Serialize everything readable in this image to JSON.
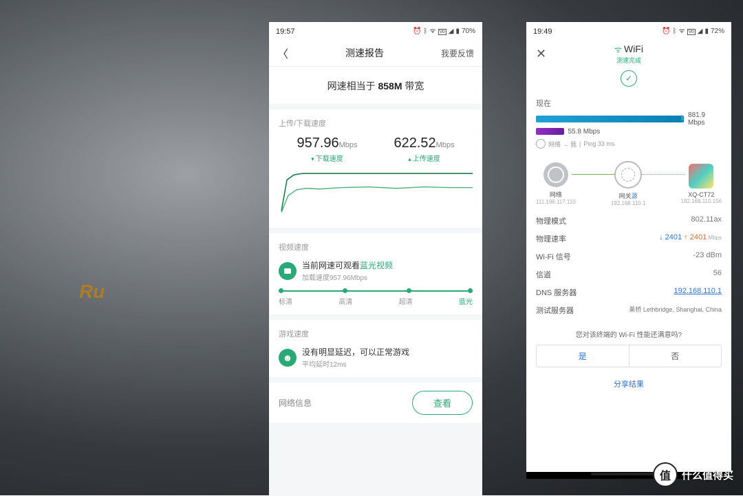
{
  "watermark": {
    "glyph": "值",
    "text": "什么值得买"
  },
  "left": {
    "status": {
      "time": "19:57",
      "battery": "70%"
    },
    "header": {
      "title": "测速报告",
      "feedback": "我要反馈"
    },
    "banner": {
      "prefix": "网速相当于 ",
      "value": "858M",
      "suffix": " 带宽"
    },
    "speed": {
      "section": "上传/下载速度",
      "download": {
        "value": "957.96",
        "unit": "Mbps",
        "label": "下载速度"
      },
      "upload": {
        "value": "622.52",
        "unit": "Mbps",
        "label": "上传速度"
      }
    },
    "video": {
      "section": "视频速度",
      "line1a": "当前网速可观看",
      "line1b": "蓝光视频",
      "line2": "加载速度957.96Mbps",
      "levels": {
        "l1": "标清",
        "l2": "高清",
        "l3": "超清",
        "l4": "蓝光"
      }
    },
    "game": {
      "section": "游戏速度",
      "line1": "没有明显延迟，可以正常游戏",
      "line2": "平均延时12ms"
    },
    "info": {
      "label": "网络信息",
      "button": "查看"
    }
  },
  "right": {
    "status": {
      "time": "19:49",
      "battery": "72%"
    },
    "title": "WiFi",
    "done": "测速完成",
    "now": "现在",
    "dl": "881.9 Mbps",
    "ul": "55.8 Mbps",
    "ping": {
      "label": "网络 → 我",
      "value": "Ping 33 ms"
    },
    "nodes": {
      "net": {
        "name": "网络",
        "ip": "111.198.117.110"
      },
      "gw": {
        "name": "网关",
        "suffix": "源",
        "ip": "192.168.110.1"
      },
      "dev": {
        "name": "XQ-CT72",
        "ip": "192.168.110.156"
      }
    },
    "kv": {
      "mode": {
        "k": "物理模式",
        "v": "802.11ax"
      },
      "rate": {
        "k": "物理速率",
        "down": "↓ 2401",
        "up": "↑ 2401",
        "unit": " Mbps"
      },
      "signal": {
        "k": "Wi-Fi 信号",
        "v": "-23 dBm"
      },
      "chan": {
        "k": "信道",
        "v": "56"
      },
      "dns": {
        "k": "DNS 服务器",
        "v": "192.168.110.1"
      },
      "server": {
        "k": "测试服务器",
        "v": "莱桥 Lethbridge, Shanghai, China"
      }
    },
    "satisfaction": {
      "q": "您对该终端的 Wi-Fi 性能还满意吗?",
      "yes": "是",
      "no": "否"
    },
    "share": "分享结果"
  },
  "chart_data": {
    "type": "line",
    "title": "上传/下载速度",
    "ylabel": "Mbps",
    "ylim": [
      0,
      1000
    ],
    "x": [
      0,
      1,
      2,
      3,
      4,
      5,
      6,
      7,
      8,
      9,
      10,
      11,
      12,
      13,
      14,
      15
    ],
    "series": [
      {
        "name": "下载速度",
        "values": [
          200,
          820,
          930,
          950,
          955,
          958,
          958,
          958,
          958,
          958,
          958,
          958,
          958,
          958,
          958,
          958
        ]
      },
      {
        "name": "上传速度",
        "values": [
          180,
          520,
          600,
          620,
          615,
          610,
          622,
          625,
          618,
          620,
          625,
          622,
          620,
          625,
          622,
          622
        ]
      }
    ]
  }
}
